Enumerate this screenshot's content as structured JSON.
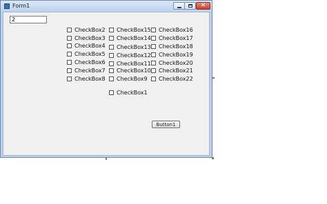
{
  "window": {
    "title": "Form1",
    "minimize_icon": "minimize-icon",
    "maximize_icon": "maximize-icon",
    "close_icon": "close-icon",
    "close_glyph": "✕"
  },
  "textbox": {
    "value": "2"
  },
  "checkboxes": {
    "col1": [
      "CheckBox2",
      "CheckBox3",
      "CheckBox4",
      "CheckBox5",
      "CheckBox6",
      "CheckBox7",
      "CheckBox8"
    ],
    "col2": [
      "CheckBox15",
      "CheckBox14",
      "CheckBox13",
      "CheckBox12",
      "CheckBox11",
      "CheckBox10",
      "CheckBox9"
    ],
    "col3": [
      "CheckBox16",
      "CheckBox17",
      "CheckBox18",
      "CheckBox19",
      "CheckBox20",
      "CheckBox21",
      "CheckBox22"
    ],
    "single": "CheckBox1"
  },
  "button1": {
    "label": "Button1"
  }
}
